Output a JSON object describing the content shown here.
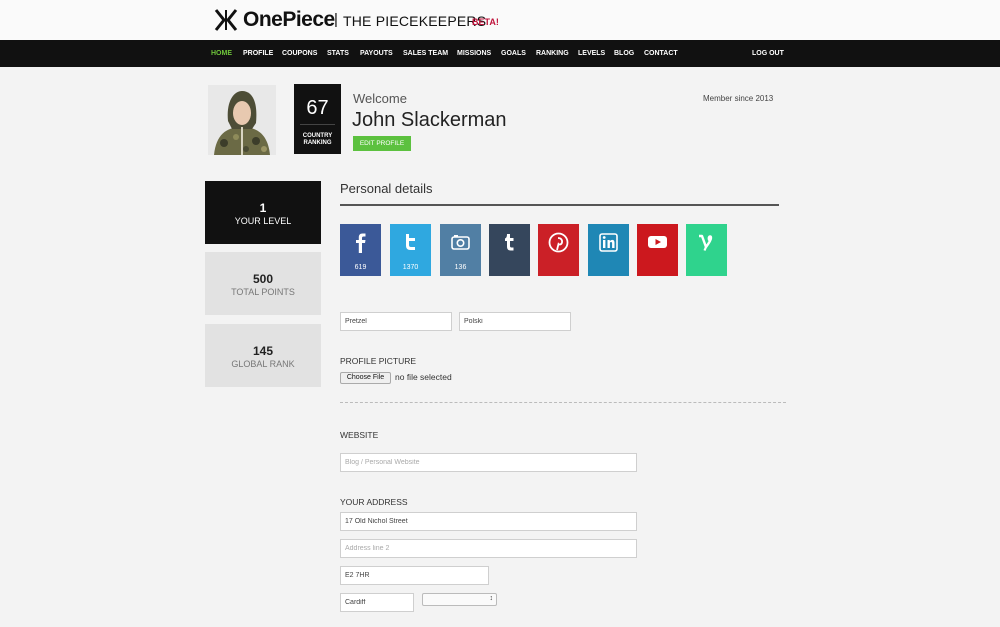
{
  "brand": {
    "name": "OnePiece",
    "separator": "|",
    "subtitle": "THE PIECEKEEPERS",
    "badge": "BETA!",
    "badge_color": "#c0143c"
  },
  "nav": {
    "items": [
      "HOME",
      "PROFILE",
      "COUPONS",
      "STATS",
      "PAYOUTS",
      "SALES TEAM",
      "MISSIONS",
      "GOALS",
      "RANKING",
      "LEVELS",
      "BLOG",
      "CONTACT"
    ],
    "active": "HOME",
    "active_color": "#6ec43a",
    "logout": "LOG OUT"
  },
  "profile": {
    "country_rank": "67",
    "country_rank_label": "COUNTRY RANKING",
    "welcome": "Welcome",
    "name": "John Slackerman",
    "edit_label": "EDIT PROFILE",
    "member_since": "Member since 2013"
  },
  "stats": {
    "level": {
      "value": "1",
      "label": "YOUR LEVEL"
    },
    "points": {
      "value": "500",
      "label": "TOTAL POINTS"
    },
    "rank": {
      "value": "145",
      "label": "GLOBAL RANK"
    }
  },
  "personal": {
    "title": "Personal details",
    "social": [
      {
        "icon": "facebook-icon",
        "count": "619",
        "color": "#3b5998"
      },
      {
        "icon": "twitter-icon",
        "count": "1370",
        "color": "#2fa8e0"
      },
      {
        "icon": "instagram-icon",
        "count": "136",
        "color": "#517fa4"
      },
      {
        "icon": "tumblr-icon",
        "count": "",
        "color": "#35465c"
      },
      {
        "icon": "pinterest-icon",
        "count": "",
        "color": "#cb2027"
      },
      {
        "icon": "linkedin-icon",
        "count": "",
        "color": "#1f87b5"
      },
      {
        "icon": "youtube-icon",
        "count": "",
        "color": "#cc181e"
      },
      {
        "icon": "vine-icon",
        "count": "",
        "color": "#2fd38d"
      }
    ],
    "first_name": "Pretzel",
    "last_name": "Polski",
    "profile_picture_label": "PROFILE PICTURE",
    "choose_file": "Choose File",
    "file_status": "no file selected",
    "website_label": "WEBSITE",
    "website_placeholder": "Blog / Personal Website",
    "address_label": "YOUR ADDRESS",
    "address_line1": "17 Old Nichol Street",
    "address_line2_placeholder": "Address line 2",
    "postcode": "E2 7HR",
    "city": "Cardiff",
    "country": ""
  }
}
